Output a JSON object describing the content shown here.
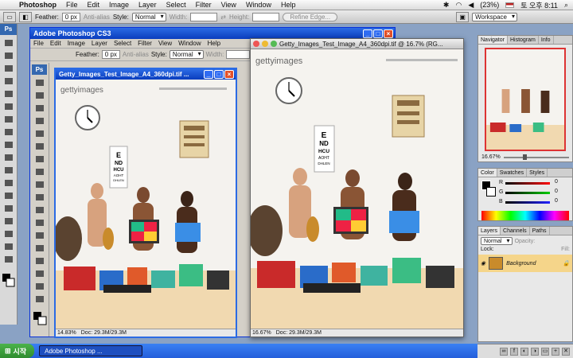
{
  "menubar": {
    "app": "Photoshop",
    "items": [
      "File",
      "Edit",
      "Image",
      "Layer",
      "Select",
      "Filter",
      "View",
      "Window",
      "Help"
    ],
    "battery": "(23%)",
    "clock": "토 오후 8:11"
  },
  "mac_options": {
    "feather_label": "Feather:",
    "feather_value": "0 px",
    "antialias": "Anti-alias",
    "style_label": "Style:",
    "style_value": "Normal",
    "width_label": "Width:",
    "height_label": "Height:",
    "refine_edge": "Refine Edge...",
    "workspace": "Workspace"
  },
  "xp_window": {
    "title": "Adobe Photoshop CS3",
    "menu": [
      "File",
      "Edit",
      "Image",
      "Layer",
      "Select",
      "Filter",
      "View",
      "Window",
      "Help"
    ],
    "feather_label": "Feather:",
    "feather_value": "0 px",
    "antialias": "Anti-alias",
    "style_label": "Style:",
    "style_value": "Normal",
    "width_label": "Width:"
  },
  "xp_doc": {
    "title": "Getty_Images_Test_Image_A4_360dpi.tif ...",
    "zoom": "14.83%",
    "doc_info": "Doc: 29.3M/29.3M"
  },
  "mac_doc": {
    "title": "Getty_Images_Test_Image_A4_360dpi.tif @ 16.7% (RG...",
    "zoom": "16.67%",
    "doc_info": "Doc: 29.3M/29.3M"
  },
  "image": {
    "brand": "gettyimages",
    "eye_chart": [
      "E",
      "ND",
      "HCU",
      "AOHT",
      "DHLEN"
    ]
  },
  "navigator": {
    "tabs": [
      "Navigator",
      "Histogram",
      "Info"
    ],
    "zoom": "16.67%"
  },
  "color_panel": {
    "tabs": [
      "Color",
      "Swatches",
      "Styles"
    ],
    "channels": [
      "R",
      "G",
      "B"
    ],
    "values": [
      "0",
      "0",
      "0"
    ]
  },
  "layers_panel": {
    "tabs": [
      "Layers",
      "Channels",
      "Paths"
    ],
    "blend": "Normal",
    "opacity_label": "Opacity:",
    "fill_label": "Fill:",
    "lock_label": "Lock:",
    "layer_name": "Background"
  },
  "taskbar": {
    "start": "시작",
    "app": "Adobe Photoshop ..."
  }
}
